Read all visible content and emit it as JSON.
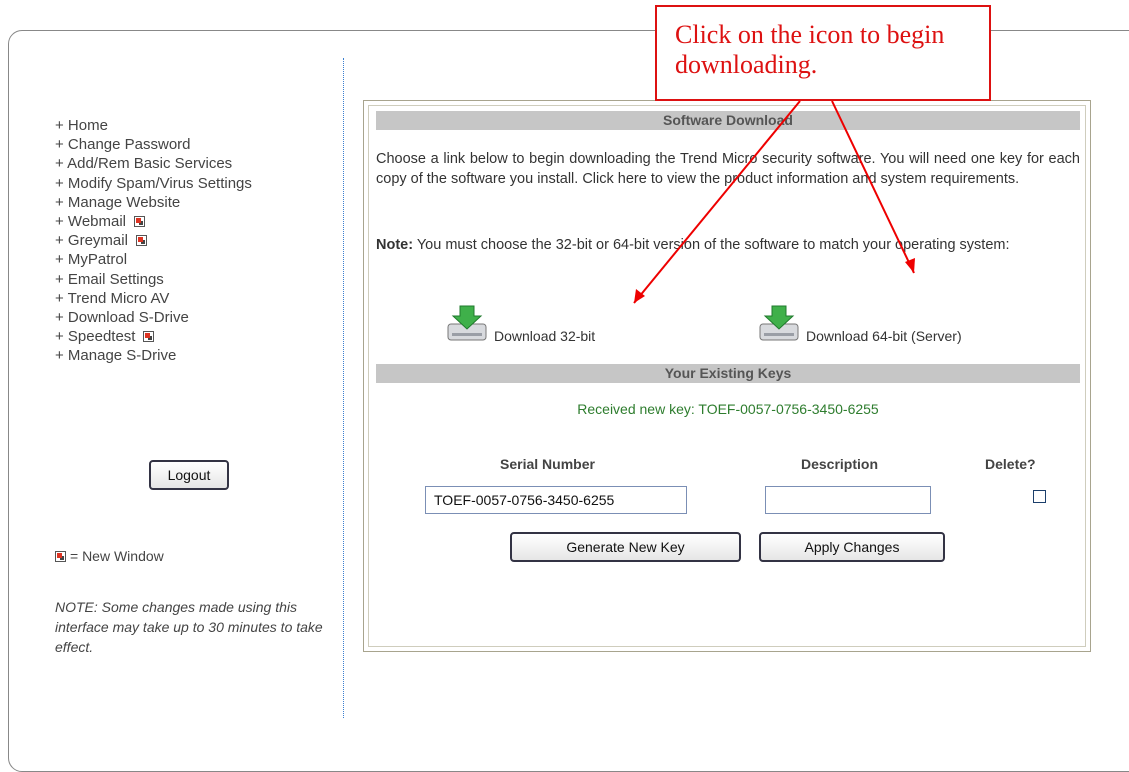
{
  "sidebar": {
    "items": [
      {
        "label": "+ Home",
        "new_window": false
      },
      {
        "label": "+ Change Password",
        "new_window": false
      },
      {
        "label": "+ Add/Rem Basic Services",
        "new_window": false
      },
      {
        "label": "+ Modify Spam/Virus Settings",
        "new_window": false
      },
      {
        "label": "+ Manage Website",
        "new_window": false
      },
      {
        "label": "+ Webmail",
        "new_window": true
      },
      {
        "label": "+ Greymail",
        "new_window": true
      },
      {
        "label": "+ MyPatrol",
        "new_window": false
      },
      {
        "label": "+ Email Settings",
        "new_window": false
      },
      {
        "label": "+ Trend Micro AV",
        "new_window": false
      },
      {
        "label": "+ Download S-Drive",
        "new_window": false
      },
      {
        "label": "+ Speedtest",
        "new_window": true
      },
      {
        "label": "+ Manage S-Drive",
        "new_window": false
      }
    ],
    "logout_label": "Logout",
    "legend_text": "= New Window",
    "note": "NOTE: Some changes made using this interface may take up to 30 minutes to take effect."
  },
  "download": {
    "header": "Software Download",
    "intro": "Choose a link below to begin downloading the Trend Micro security software. You will need one key for each copy of the software you install. Click here to view the product information and system requirements.",
    "note_label": "Note:",
    "note_text": " You must choose the 32-bit or 64-bit version of the software to match your operating system:",
    "link_32": "Download 32-bit",
    "link_64": "Download 64-bit (Server)"
  },
  "keys": {
    "header": "Your Existing Keys",
    "received": "Received new key: TOEF-0057-0756-3450-6255",
    "col_serial": "Serial Number",
    "col_description": "Description",
    "col_delete": "Delete?",
    "serial_value": "TOEF-0057-0756-3450-6255",
    "description_value": "",
    "generate_label": "Generate New Key",
    "apply_label": "Apply Changes"
  },
  "callout": {
    "text": "Click on the icon to begin downloading."
  },
  "colors": {
    "accent_red": "#dd1111",
    "received_green": "#2e7d2e",
    "header_bar": "#c6c6c6"
  }
}
